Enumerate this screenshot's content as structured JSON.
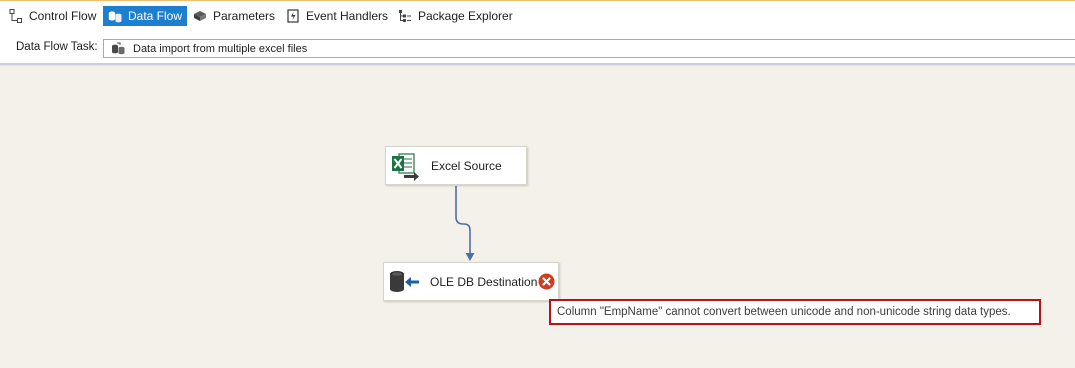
{
  "tabs": [
    {
      "label": "Control Flow",
      "icon": "control-flow-icon",
      "active": false
    },
    {
      "label": "Data Flow",
      "icon": "data-flow-icon",
      "active": true
    },
    {
      "label": "Parameters",
      "icon": "parameters-icon",
      "active": false
    },
    {
      "label": "Event Handlers",
      "icon": "event-handlers-icon",
      "active": false
    },
    {
      "label": "Package Explorer",
      "icon": "package-explorer-icon",
      "active": false
    }
  ],
  "task": {
    "label": "Data Flow Task:",
    "value": "Data import from multiple excel files",
    "icon": "data-flow-task-icon"
  },
  "canvas": {
    "nodes": [
      {
        "label": "Excel Source",
        "icon": "excel-source-icon"
      },
      {
        "label": "OLE DB Destination",
        "icon": "ole-db-destination-icon",
        "status": "error",
        "status_icon": "error-icon"
      }
    ],
    "error_tooltip": "Column \"EmpName\" cannot convert between unicode and non-unicode string data types."
  },
  "colors": {
    "active_tab": "#1c7fcf",
    "canvas_background": "#f4f1ea",
    "connector": "#4f6fa8",
    "error_red": "#d23c1e",
    "tooltip_border": "#b5121b",
    "excel_green": "#1e7145"
  }
}
